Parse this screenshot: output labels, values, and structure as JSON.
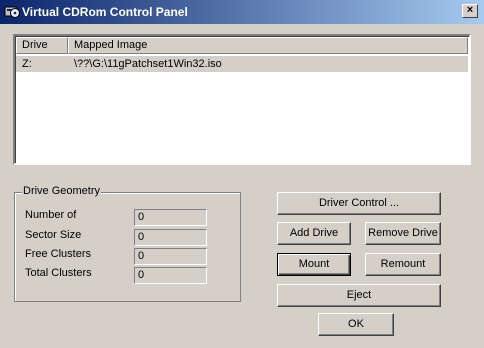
{
  "window": {
    "title": "Virtual CDRom Control Panel",
    "close_label": "×"
  },
  "list": {
    "columns": [
      "Drive",
      "Mapped Image"
    ],
    "rows": [
      {
        "drive": "Z:",
        "image": "\\??\\G:\\11gPatchset1Win32.iso",
        "selected": true
      }
    ]
  },
  "geometry": {
    "label": "Drive Geometry",
    "fields": [
      {
        "label": "Number of",
        "value": "0"
      },
      {
        "label": "Sector Size",
        "value": "0"
      },
      {
        "label": "Free Clusters",
        "value": "0"
      },
      {
        "label": "Total Clusters",
        "value": "0"
      }
    ]
  },
  "buttons": {
    "driver_control": "Driver Control ...",
    "add_drive": "Add Drive",
    "remove_drive": "Remove Drive",
    "mount": "Mount",
    "remount": "Remount",
    "eject": "Eject",
    "ok": "OK"
  },
  "colors": {
    "face": "#d4d0c8",
    "title_start": "#0a246a",
    "title_end": "#a6caf0"
  }
}
